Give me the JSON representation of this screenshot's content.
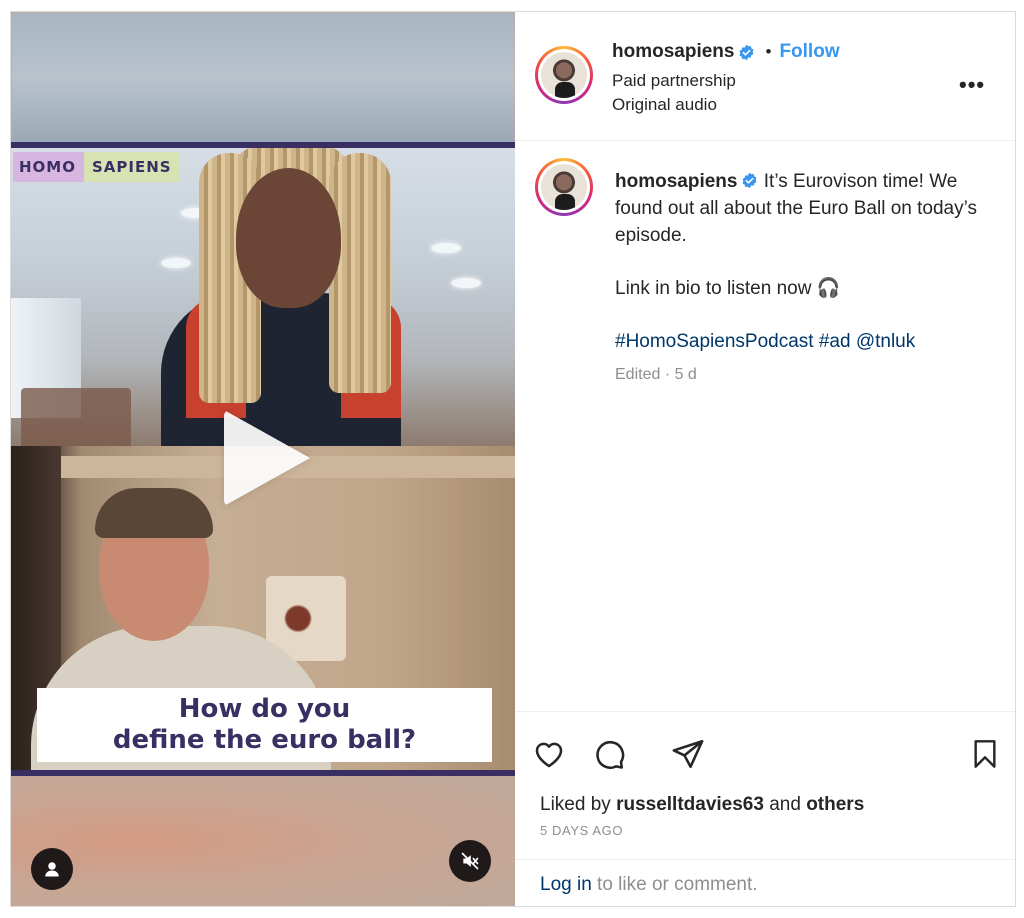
{
  "media": {
    "brand_left": "HOMO",
    "brand_right": "SAPIENS",
    "caption_line1": "How do you",
    "caption_line2": "define the euro ball?",
    "play_icon": "play-icon",
    "user_icon": "user-icon",
    "mute_icon": "muted-speaker-icon"
  },
  "header": {
    "username": "homosapiens",
    "separator": "•",
    "follow_label": "Follow",
    "subtitle1": "Paid partnership",
    "subtitle2": "Original audio",
    "more_label": "•••"
  },
  "post": {
    "username": "homosapiens",
    "caption_text1": "It’s Eurovison time! We found out all about the Euro Ball on today’s episode.",
    "caption_text2": "Link in bio to listen now 🎧",
    "hashtags": "#HomoSapiensPodcast #ad @tnluk",
    "edited": "Edited · 5 d"
  },
  "actions": {
    "liked_prefix": "Liked by",
    "liked_user": "russelltdavies63",
    "liked_and": "and",
    "liked_others": "others",
    "time_ago": "5 DAYS AGO"
  },
  "footer": {
    "login_link": "Log in",
    "login_rest": " to like or comment."
  },
  "colors": {
    "accent_blue": "#3897f0",
    "link_navy": "#00376b",
    "brand_purple": "#3a2f63",
    "verified_blue": "#3897f0"
  }
}
